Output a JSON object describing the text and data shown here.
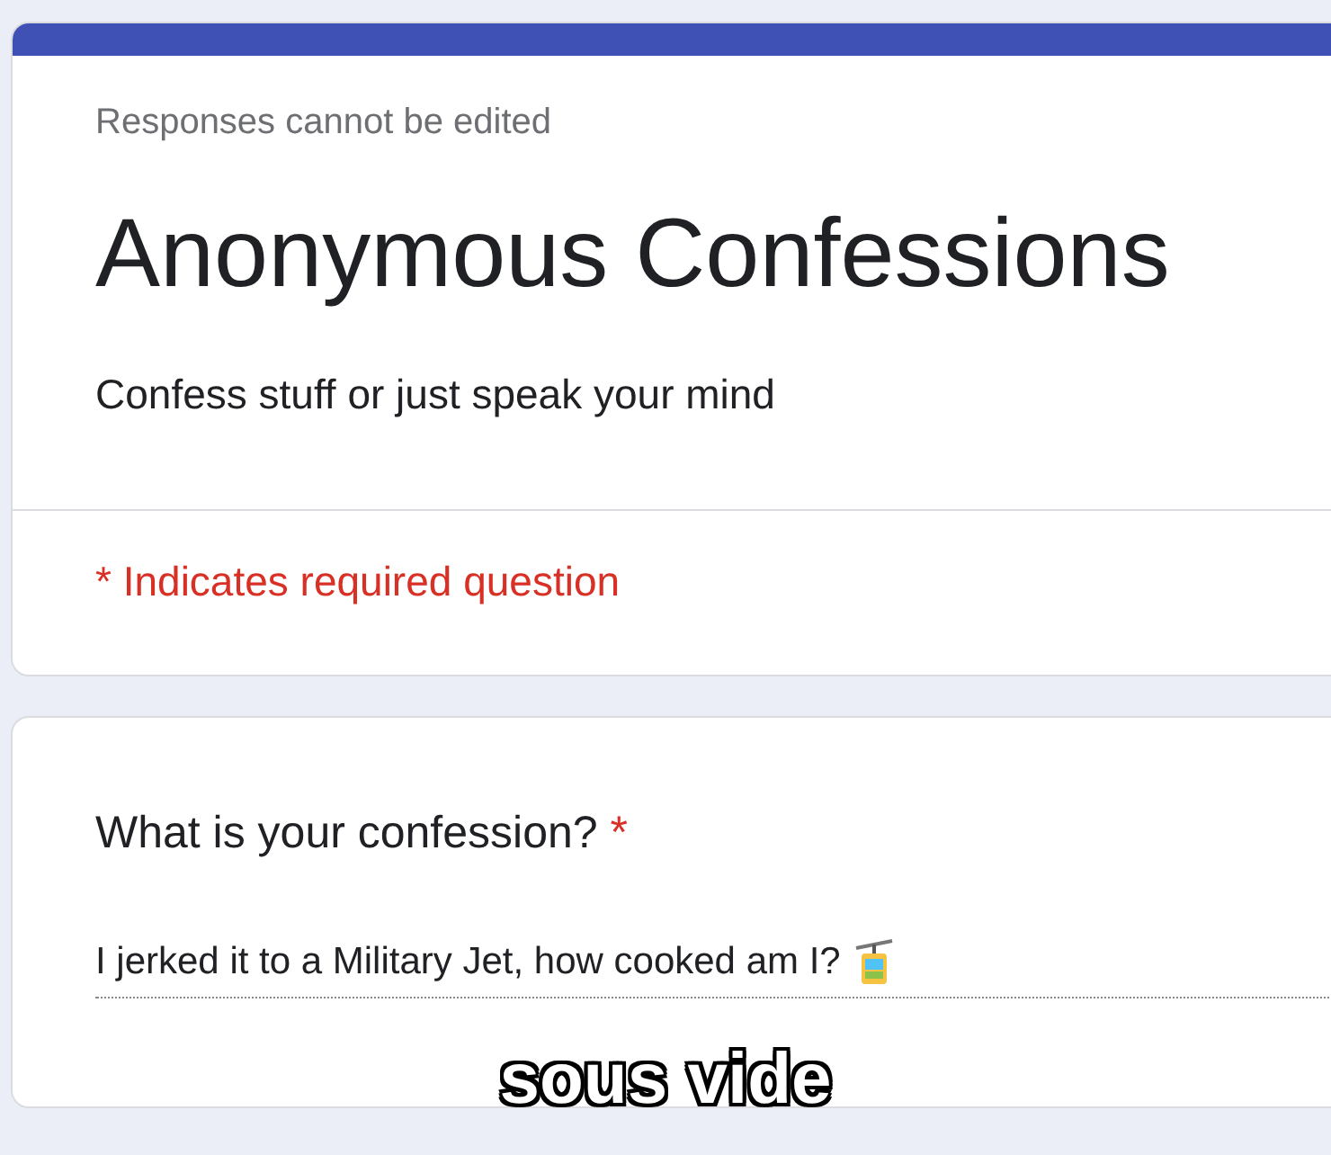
{
  "header_card": {
    "notice": "Responses cannot be edited",
    "title": "Anonymous Confessions",
    "description": "Confess stuff or just speak your mind",
    "required_note": "* Indicates required question"
  },
  "question_card": {
    "question": "What is your confession?",
    "required": true,
    "required_mark": "*",
    "answer": "I jerked it to a Military Jet, how cooked am I?"
  },
  "caption": "sous vide"
}
